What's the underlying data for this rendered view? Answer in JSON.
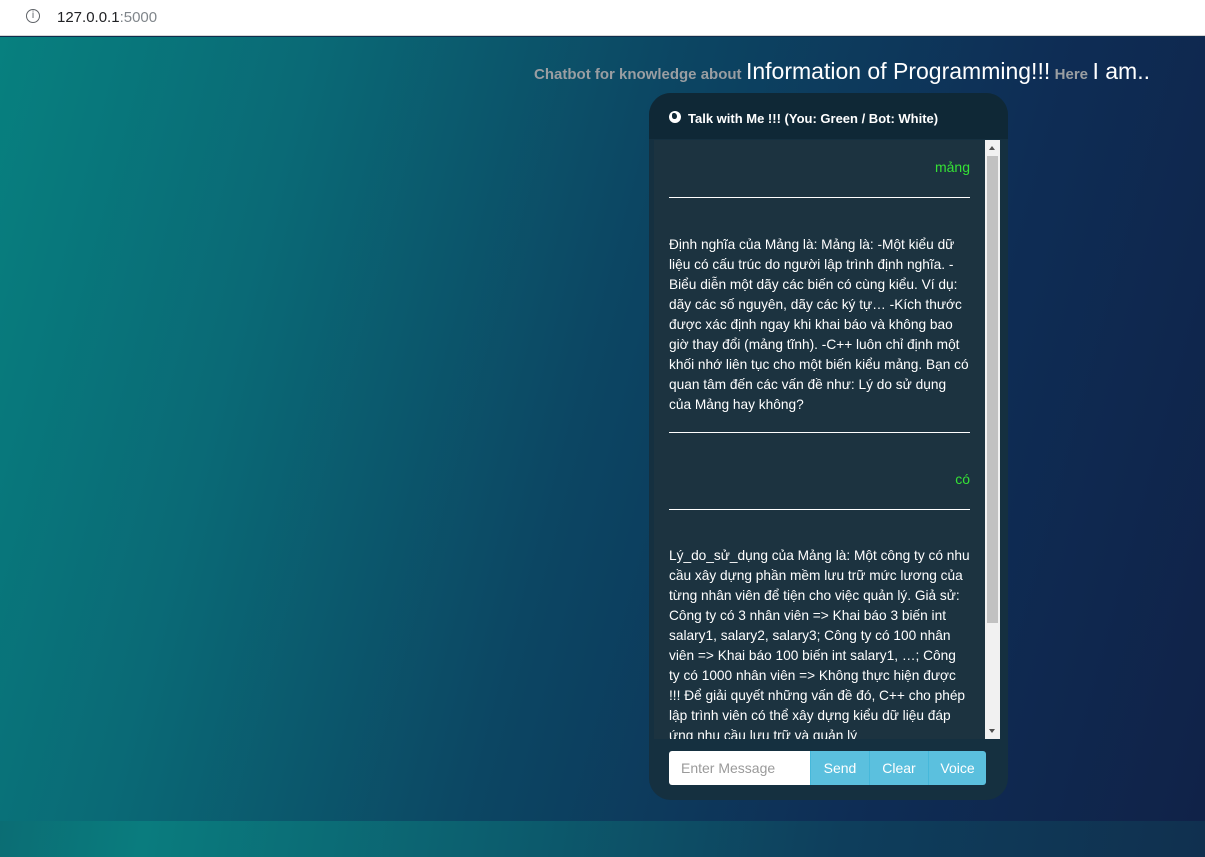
{
  "browser": {
    "url_host": "127.0.0.1",
    "url_port": ":5000"
  },
  "headline": {
    "part1": "Chatbot for knowledge about",
    "part2": "Information of Programming!!!",
    "part3": "Here",
    "part4": "I am.."
  },
  "chat": {
    "header_title": "Talk with Me !!! (You: Green / Bot: White)",
    "messages": {
      "user1": "mảng",
      "bot1": "Định nghĩa của Mảng là: Mảng là: -Một kiểu dữ liệu có cấu trúc do người lập trình định nghĩa. -Biểu diễn một dãy các biến có cùng kiểu. Ví dụ: dãy các số nguyên, dãy các ký tự… -Kích thước được xác định ngay khi khai báo và không bao giờ thay đổi (mảng tĩnh). -C++ luôn chỉ định một khối nhớ liên tục cho một biến kiểu mảng. Bạn có quan tâm đến các vấn đề như: Lý do sử dụng của Mảng hay không?",
      "user2": "có",
      "bot2": "Lý_do_sử_dụng của Mảng là: Một công ty có nhu cầu xây dựng phần mềm lưu trữ mức lương của từng nhân viên để tiện cho việc quản lý. Giả sử: Công ty có 3 nhân viên => Khai báo 3 biến int salary1, salary2, salary3; Công ty có 100 nhân viên => Khai báo 100 biến int salary1, …; Công ty có 1000 nhân viên => Không thực hiện được !!! Để giải quyết những vấn đề đó, C++ cho phép lập trình viên có thể xây dựng kiểu dữ liệu đáp ứng nhu cầu lưu trữ và quản lý"
    },
    "input_placeholder": "Enter Message",
    "send_label": "Send",
    "clear_label": "Clear",
    "voice_label": "Voice"
  },
  "icons": {
    "browser_info": "info-icon",
    "header": "globe-icon"
  },
  "colors": {
    "user_text": "#35e235",
    "bot_text": "#ffffff",
    "button": "#5bc0de"
  }
}
